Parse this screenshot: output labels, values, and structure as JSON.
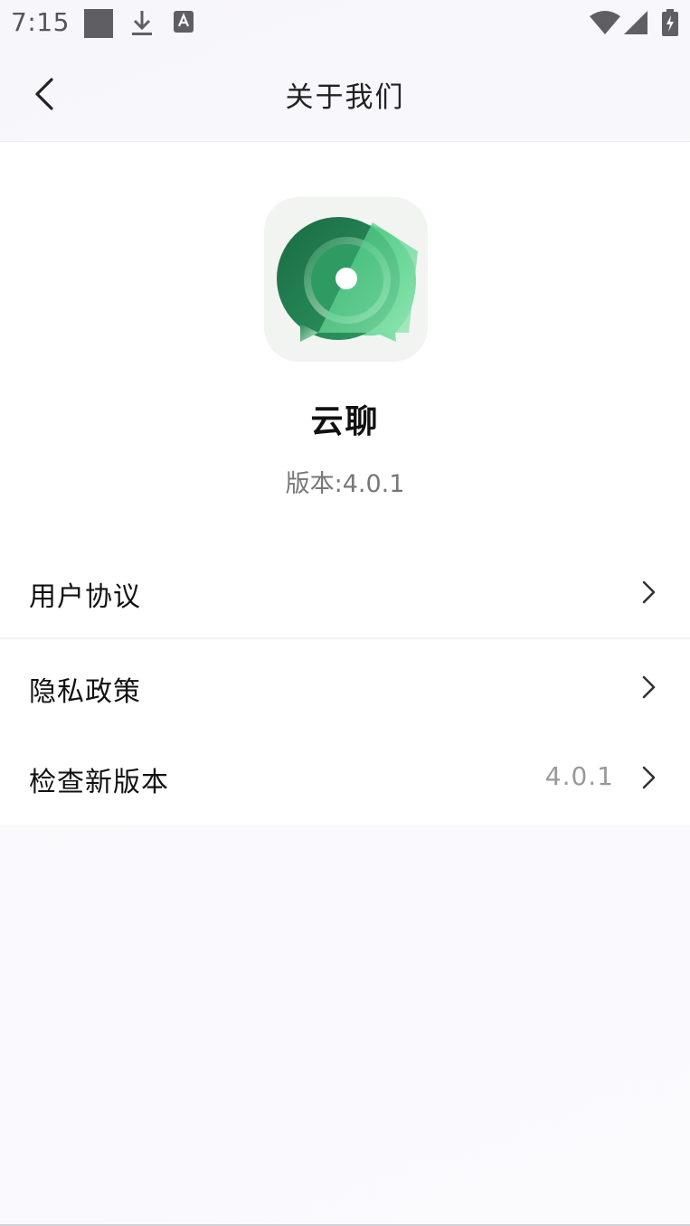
{
  "status_bar": {
    "time": "7:15",
    "icons": [
      "notification-square-icon",
      "download-icon",
      "a-keyboard-icon",
      "wifi-icon",
      "cellular-signal-icon",
      "battery-charging-icon"
    ]
  },
  "header": {
    "title": "关于我们",
    "back_icon": "chevron-left-icon"
  },
  "app": {
    "name": "云聊",
    "version": "版本:4.0.1",
    "logo_colors": [
      "#1e7a4c",
      "#3fc67a",
      "#f2f4f1"
    ]
  },
  "menu": {
    "items": [
      {
        "label": "用户协议",
        "value": ""
      },
      {
        "label": "隐私政策",
        "value": ""
      },
      {
        "label": "检查新版本",
        "value": "4.0.1"
      }
    ]
  }
}
